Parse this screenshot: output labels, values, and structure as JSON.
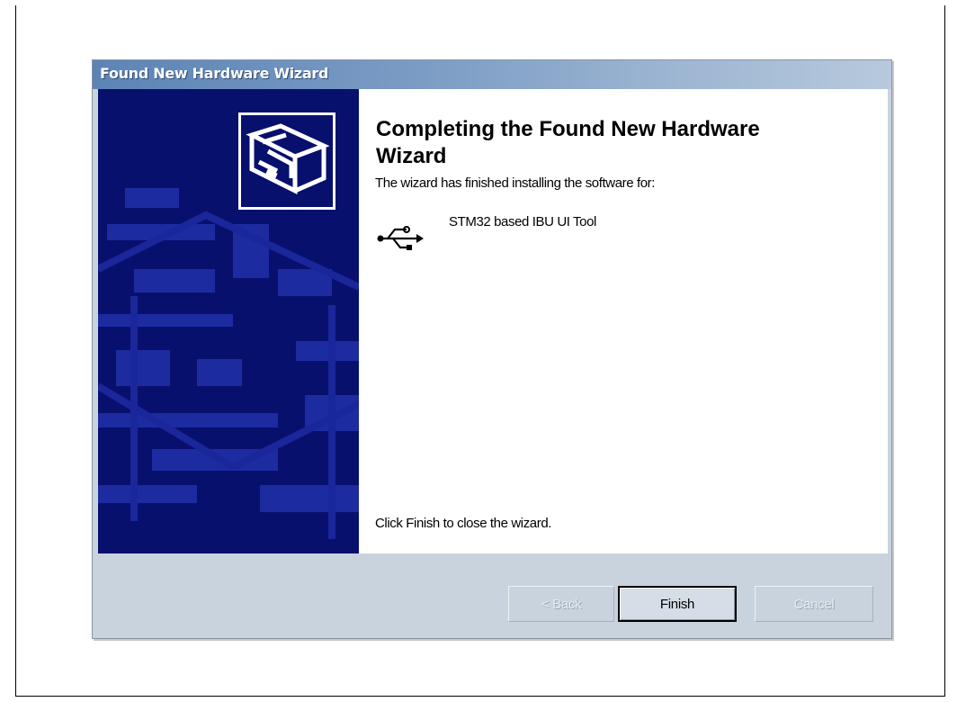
{
  "window": {
    "title": "Found New Hardware Wizard"
  },
  "content": {
    "heading": "Completing the Found New Hardware Wizard",
    "finished_text": "The wizard has finished installing the software for:",
    "device_name": "STM32 based IBU UI Tool",
    "device_icon": "usb-icon",
    "close_instruction": "Click Finish to close the wizard."
  },
  "buttons": {
    "back_label": "< Back",
    "finish_label": "Finish",
    "cancel_label": "Cancel"
  },
  "colors": {
    "side_panel": "#08106e",
    "titlebar": "#6f93c0",
    "dialog_bg": "#c9d3dd"
  }
}
